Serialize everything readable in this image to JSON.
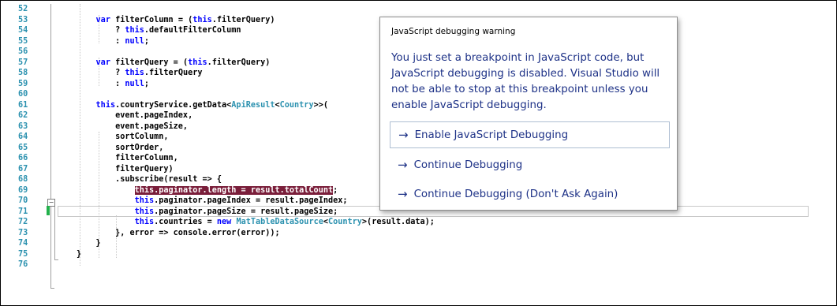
{
  "editor": {
    "lines": [
      {
        "n": "52",
        "html": ""
      },
      {
        "n": "53",
        "html": "    <span class='kw'>var</span> filterColumn = (<span class='kw'>this</span>.filterQuery)"
      },
      {
        "n": "54",
        "html": "        ? <span class='kw'>this</span>.defaultFilterColumn"
      },
      {
        "n": "55",
        "html": "        : <span class='kw'>null</span>;"
      },
      {
        "n": "56",
        "html": ""
      },
      {
        "n": "57",
        "html": "    <span class='kw'>var</span> filterQuery = (<span class='kw'>this</span>.filterQuery)"
      },
      {
        "n": "58",
        "html": "        ? <span class='kw'>this</span>.filterQuery"
      },
      {
        "n": "59",
        "html": "        : <span class='kw'>null</span>;"
      },
      {
        "n": "60",
        "html": ""
      },
      {
        "n": "61",
        "html": "    <span class='kw'>this</span>.countryService.getData&lt;<span class='ty'>ApiResult</span>&lt;<span class='ty'>Country</span>&gt;&gt;("
      },
      {
        "n": "62",
        "html": "        event.pageIndex,"
      },
      {
        "n": "63",
        "html": "        event.pageSize,"
      },
      {
        "n": "64",
        "html": "        sortColumn,"
      },
      {
        "n": "65",
        "html": "        sortOrder,"
      },
      {
        "n": "66",
        "html": "        filterColumn,"
      },
      {
        "n": "67",
        "html": "        filterQuery)"
      },
      {
        "n": "68",
        "html": "        .subscribe(result =&gt; {"
      },
      {
        "n": "69",
        "html": "            <span class='bp-hl'><span style='color:#ffffff'>this</span>.paginator.length = result.totalCount</span>;"
      },
      {
        "n": "70",
        "html": "            <span class='kw'>this</span>.paginator.pageIndex = result.pageIndex;"
      },
      {
        "n": "71",
        "html": "            <span class='kw'>this</span>.paginator.pageSize = result.pageSize;"
      },
      {
        "n": "72",
        "html": "            <span class='kw'>this</span>.countries = <span class='kw'>new</span> <span class='ty'>MatTableDataSource</span>&lt;<span class='ty'>Country</span>&gt;(result.data);"
      },
      {
        "n": "73",
        "html": "        }, error =&gt; console.error(error));"
      },
      {
        "n": "74",
        "html": "    }"
      },
      {
        "n": "75",
        "html": "}"
      },
      {
        "n": "76",
        "html": ""
      }
    ]
  },
  "dialog": {
    "title": "JavaScript debugging warning",
    "message": "You just set a breakpoint in JavaScript code, but JavaScript debugging is disabled. Visual Studio will not be able to stop at this breakpoint unless you enable JavaScript debugging.",
    "arrow_icon": "right-arrow-icon",
    "options": [
      {
        "label": "Enable JavaScript Debugging"
      },
      {
        "label": "Continue Debugging"
      },
      {
        "label": "Continue Debugging (Don't Ask Again)"
      }
    ]
  },
  "colors": {
    "line_number": "#2b91af",
    "keyword": "#0000ff",
    "type": "#2b91af",
    "breakpoint_highlight": "#7a1e3a",
    "change_bar": "#22b14c",
    "dialog_text": "#1e3287"
  }
}
